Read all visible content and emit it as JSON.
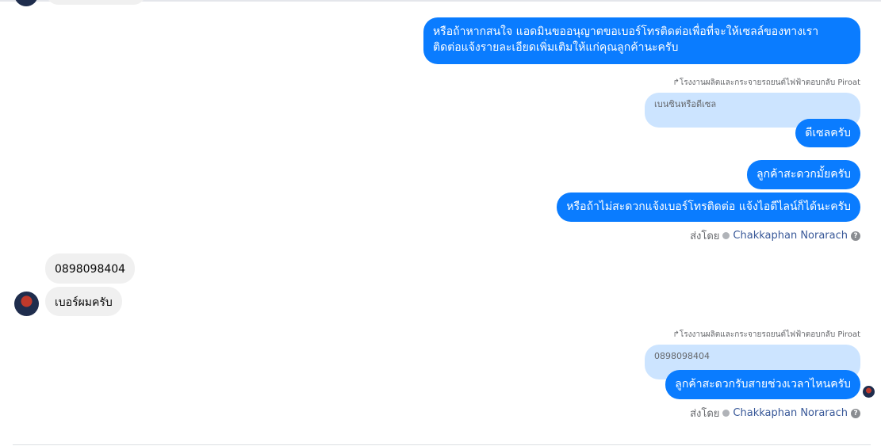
{
  "messages": {
    "m1": "หรือถ้าหากสนใจ แอดมินขออนุญาตขอเบอร์โทรติดต่อเพื่อที่จะให้เซลล์ของทางเรา",
    "m1b": "ติดต่อแจ้งรายละเอียดเพิ่มเติมให้แก่คุณลูกค้านะครับ",
    "reply1_label": "↱โรงงานผลิตและกระจายรถยนต์ไฟฟ้าตอบกลับ Piroat",
    "reply1_quote": "เบนซินหรือดีเซล",
    "m2": "ดีเซลครับ",
    "m3": "ลูกค้าสะดวกมั้ยครับ",
    "m4": "หรือถ้าไม่สะดวกแจ้งเบอร์โทรติดต่อ แจ้งไอดีไลน์ก็ได้นะครับ",
    "sent_by_prefix": "ส่งโดย",
    "sent_by_name": "Chakkaphan Norarach",
    "in1": "0898098404",
    "in2": "เบอร์ผมครับ",
    "reply2_label": "↱โรงงานผลิตและกระจายรถยนต์ไฟฟ้าตอบกลับ Piroat",
    "reply2_quote": "0898098404",
    "m5": "ลูกค้าสะดวกรับสายช่วงเวลาไหนครับ",
    "sent_by_prefix2": "ส่งโดย",
    "sent_by_name2": "Chakkaphan Norarach"
  },
  "icons": {
    "seen_check": "check-circle-icon",
    "help": "question-icon",
    "avatar": "avatar"
  },
  "colors": {
    "outgoing": "#0a7cff",
    "incoming": "#f0f0f0",
    "quote": "#cce4ff",
    "link": "#385898"
  }
}
